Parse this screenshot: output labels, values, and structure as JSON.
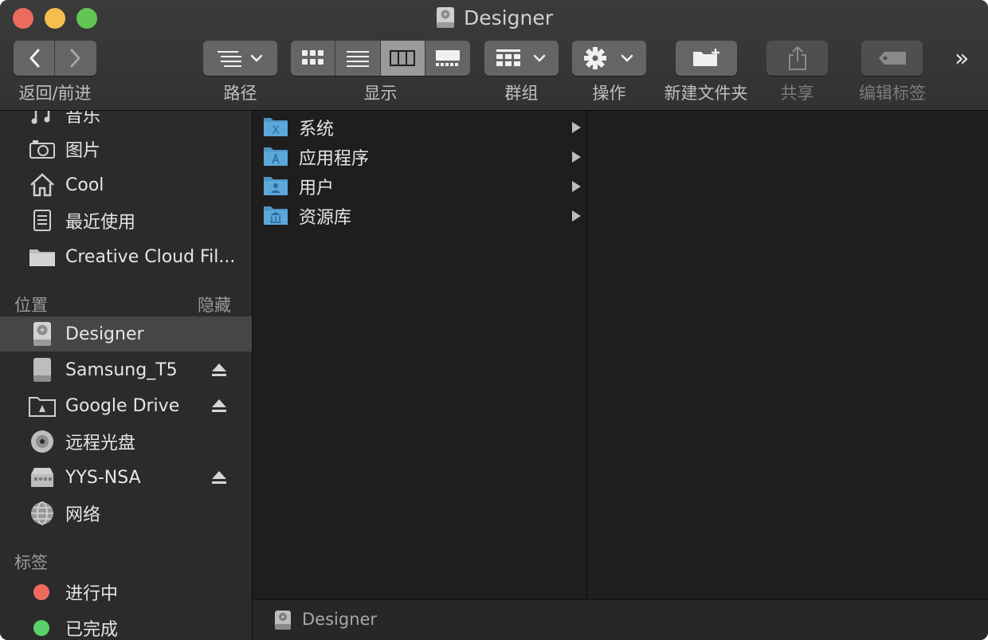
{
  "window": {
    "title": "Designer"
  },
  "toolbar": {
    "nav_label": "返回/前进",
    "path_label": "路径",
    "view_label": "显示",
    "group_label": "群组",
    "action_label": "操作",
    "new_folder_label": "新建文件夹",
    "share_label": "共享",
    "edit_tags_label": "编辑标签",
    "more_glyph": "»"
  },
  "sidebar": {
    "items_top": [
      {
        "label": "音乐",
        "icon": "music-icon"
      },
      {
        "label": "图片",
        "icon": "camera-icon"
      },
      {
        "label": "Cool",
        "icon": "home-icon"
      },
      {
        "label": "最近使用",
        "icon": "recents-icon"
      },
      {
        "label": "Creative Cloud Fil...",
        "icon": "folder-icon"
      }
    ],
    "locations_header": "位置",
    "locations_hide": "隐藏",
    "locations": [
      {
        "label": "Designer",
        "icon": "hard-disk-icon",
        "selected": true,
        "eject": false
      },
      {
        "label": "Samsung_T5",
        "icon": "external-disk-icon",
        "selected": false,
        "eject": true
      },
      {
        "label": "Google Drive",
        "icon": "google-drive-icon",
        "selected": false,
        "eject": true
      },
      {
        "label": "远程光盘",
        "icon": "optical-disc-icon",
        "selected": false,
        "eject": false
      },
      {
        "label": "YYS-NSA",
        "icon": "network-server-icon",
        "selected": false,
        "eject": true
      },
      {
        "label": "网络",
        "icon": "network-globe-icon",
        "selected": false,
        "eject": false
      }
    ],
    "tags_header": "标签",
    "tags": [
      {
        "label": "进行中",
        "color": "#ee6a5f"
      },
      {
        "label": "已完成",
        "color": "#5ad06a"
      }
    ]
  },
  "browser": {
    "column1": [
      {
        "label": "系统",
        "icon": "system-folder-icon"
      },
      {
        "label": "应用程序",
        "icon": "applications-folder-icon"
      },
      {
        "label": "用户",
        "icon": "users-folder-icon"
      },
      {
        "label": "资源库",
        "icon": "library-folder-icon"
      }
    ]
  },
  "pathbar": {
    "label": "Designer"
  },
  "colors": {
    "folder_blue": "#5ba8db",
    "close": "#ed6a5e",
    "minimize": "#f5bf4f",
    "maximize": "#62c554"
  }
}
